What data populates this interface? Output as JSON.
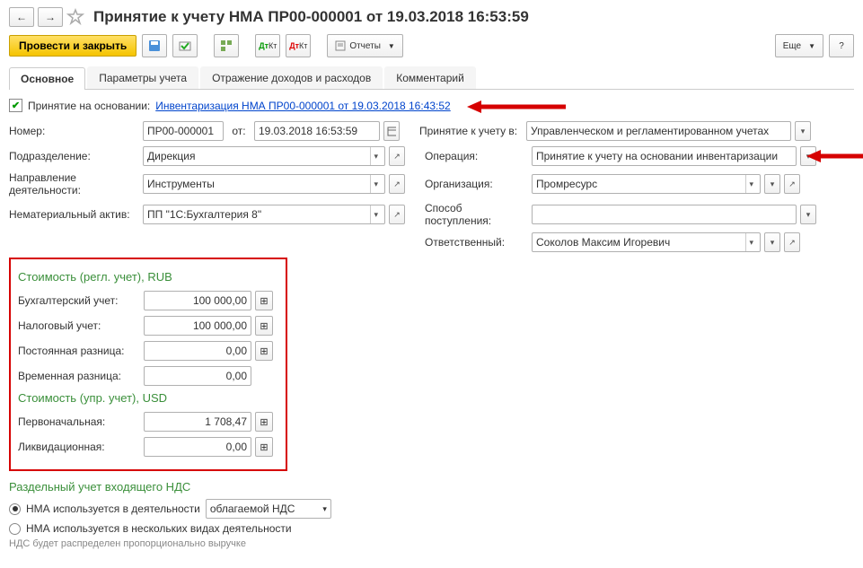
{
  "header": {
    "title": "Принятие к учету НМА ПР00-000001 от 19.03.2018 16:53:59"
  },
  "toolbar": {
    "primary": "Провести и закрыть",
    "reports": "Отчеты",
    "more": "Еще",
    "help": "?"
  },
  "tabs": [
    "Основное",
    "Параметры учета",
    "Отражение доходов и расходов",
    "Комментарий"
  ],
  "basis": {
    "checkbox_label": "Принятие на основании:",
    "link": "Инвентаризация НМА ПР00-000001 от 19.03.2018 16:43:52"
  },
  "main": {
    "number_label": "Номер:",
    "number": "ПР00-000001",
    "ot": "от:",
    "date": "19.03.2018 16:53:59",
    "accounting_label": "Принятие к учету в:",
    "accounting": "Управленческом и регламентированном учетах",
    "dept_label": "Подразделение:",
    "dept": "Дирекция",
    "operation_label": "Операция:",
    "operation": "Принятие к учету на основании инвентаризации",
    "activity_label": "Направление деятельности:",
    "activity": "Инструменты",
    "org_label": "Организация:",
    "org": "Промресурс",
    "asset_label": "Нематериальный актив:",
    "asset": "ПП \"1С:Бухгалтерия 8\"",
    "receipt_label": "Способ поступления:",
    "receipt": "",
    "responsible_label": "Ответственный:",
    "responsible": "Соколов Максим Игоревич"
  },
  "cost": {
    "hdr_reg": "Стоимость (регл. учет), RUB",
    "buh_label": "Бухгалтерский учет:",
    "buh": "100 000,00",
    "tax_label": "Налоговый учет:",
    "tax": "100 000,00",
    "perm_label": "Постоянная разница:",
    "perm": "0,00",
    "temp_label": "Временная разница:",
    "temp": "0,00",
    "hdr_upr": "Стоимость (упр. учет), USD",
    "init_label": "Первоначальная:",
    "init": "1 708,47",
    "liq_label": "Ликвидационная:",
    "liq": "0,00"
  },
  "vat": {
    "hdr": "Раздельный учет входящего НДС",
    "opt1": "НМА используется в деятельности",
    "opt1_val": "облагаемой НДС",
    "opt2": "НМА используется в нескольких видах деятельности",
    "hint": "НДС будет распределен пропорционально выручке"
  }
}
